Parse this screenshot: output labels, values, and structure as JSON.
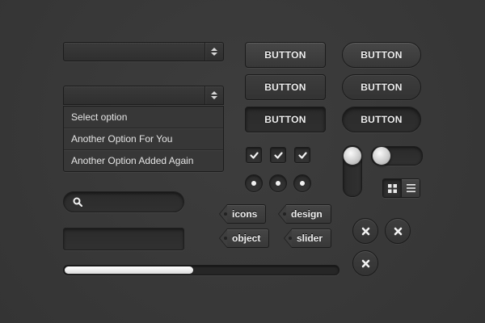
{
  "select_closed": {
    "value": ""
  },
  "select_open": {
    "value": "",
    "options": [
      "Select option",
      "Another Option For You",
      "Another Option Added Again"
    ]
  },
  "search": {
    "placeholder": ""
  },
  "text_field": {
    "value": ""
  },
  "progress": {
    "fraction": 0.47
  },
  "buttons": {
    "square": [
      "BUTTON",
      "BUTTON",
      "BUTTON"
    ],
    "rounded": [
      "BUTTON",
      "BUTTON",
      "BUTTON"
    ]
  },
  "checkboxes": [
    true,
    true,
    true
  ],
  "radios": [
    true,
    true,
    true
  ],
  "toggles": {
    "vertical_on": true,
    "horizontal_on": false
  },
  "view_switch": {
    "selected": "grid"
  },
  "tags": [
    "icons",
    "design",
    "object",
    "slider"
  ],
  "close_buttons": 3,
  "colors": {
    "background": "#373737",
    "text": "#f0f0f0",
    "progress_fill": "#ffffff"
  }
}
